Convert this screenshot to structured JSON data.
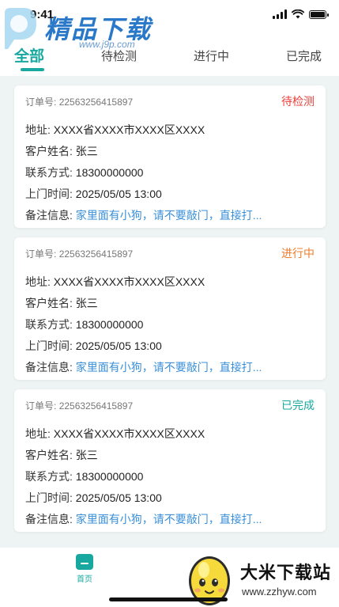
{
  "status_bar": {
    "time": "9:41"
  },
  "watermark": {
    "title": "精品下载",
    "url": "www.j9p.com"
  },
  "tabs": [
    {
      "label": "全部",
      "active": true
    },
    {
      "label": "待检测",
      "active": false
    },
    {
      "label": "进行中",
      "active": false
    },
    {
      "label": "已完成",
      "active": false
    }
  ],
  "labels": {
    "order": "订单号:",
    "address": "地址:",
    "customer": "客户姓名:",
    "contact": "联系方式:",
    "visit_time": "上门时间:",
    "note": "备注信息:"
  },
  "orders": [
    {
      "order_no": "22563256415897",
      "status": "待检测",
      "status_color": "#e8413c",
      "address": "XXXX省XXXX市XXXX区XXXX",
      "customer": "张三",
      "phone": "18300000000",
      "visit_time": "2025/05/05  13:00",
      "note": "家里面有小狗，请不要敲门，直接打..."
    },
    {
      "order_no": "22563256415897",
      "status": "进行中",
      "status_color": "#ef7d2a",
      "address": "XXXX省XXXX市XXXX区XXXX",
      "customer": "张三",
      "phone": "18300000000",
      "visit_time": "2025/05/05  13:00",
      "note": "家里面有小狗，请不要敲门，直接打..."
    },
    {
      "order_no": "22563256415897",
      "status": "已完成",
      "status_color": "#19a8a0",
      "address": "XXXX省XXXX市XXXX区XXXX",
      "customer": "张三",
      "phone": "18300000000",
      "visit_time": "2025/05/05  13:00",
      "note": "家里面有小狗，请不要敲门，直接打..."
    }
  ],
  "bottom_nav": {
    "home_label": "首页"
  },
  "bottom_watermark": {
    "title": "大米下载站",
    "url": "www.zzhyw.com"
  },
  "colors": {
    "accent": "#19a8a0",
    "note": "#3a8fd8",
    "background": "#eef3f3"
  }
}
